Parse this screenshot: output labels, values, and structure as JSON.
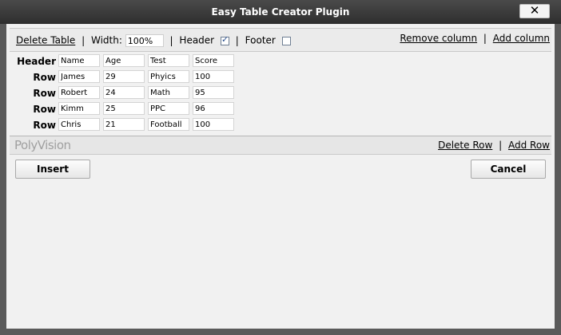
{
  "dialog": {
    "title": "Easy Table Creator Plugin",
    "close_label": "✕"
  },
  "toolbar": {
    "delete_table": "Delete Table",
    "sep": "|",
    "width_label": "Width:",
    "width_value": "100%",
    "header_label": "Header",
    "header_checked": true,
    "footer_label": "Footer",
    "footer_checked": false,
    "remove_column": "Remove column",
    "add_column": "Add column"
  },
  "table": {
    "header_row_label": "Header",
    "headers": [
      "Name",
      "Age",
      "Test",
      "Score"
    ],
    "row_label": "Row",
    "rows": [
      [
        "James",
        "29",
        "Phyics",
        "100"
      ],
      [
        "Robert",
        "24",
        "Math",
        "95"
      ],
      [
        "Kimm",
        "25",
        "PPC",
        "96"
      ],
      [
        "Chris",
        "21",
        "Football",
        "100"
      ]
    ]
  },
  "footer": {
    "logo": "PolyVision",
    "delete_row": "Delete Row",
    "add_row": "Add Row"
  },
  "buttons": {
    "insert": "Insert",
    "cancel": "Cancel"
  }
}
